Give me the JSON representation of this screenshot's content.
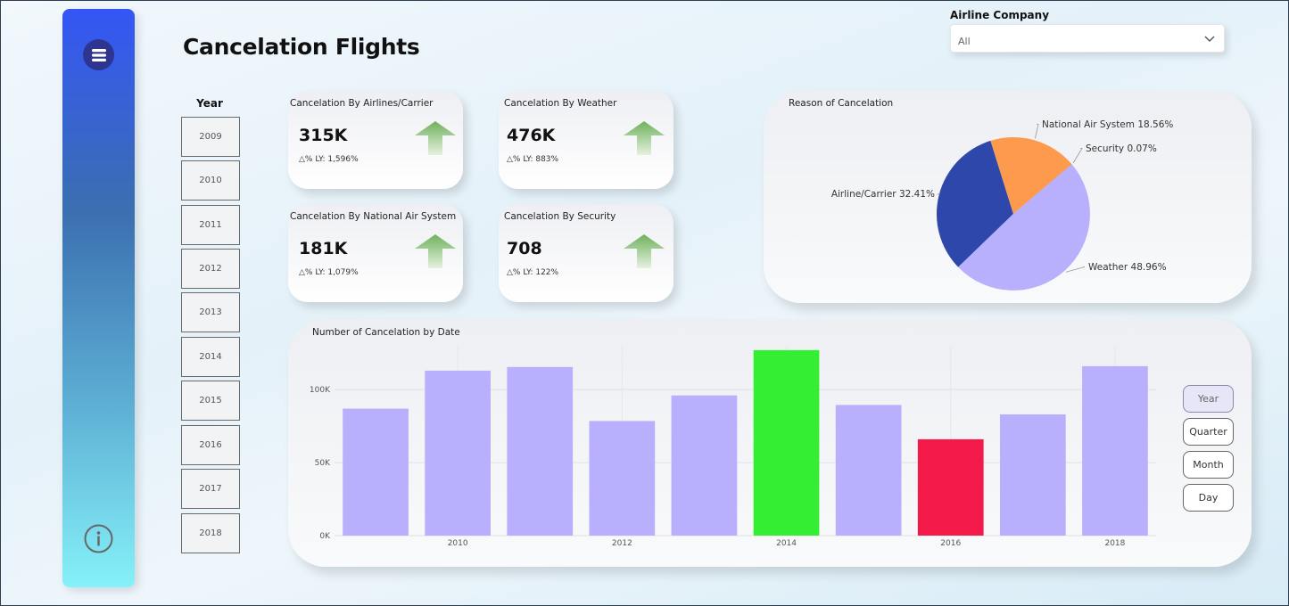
{
  "page": {
    "title": "Cancelation Flights"
  },
  "filter": {
    "label": "Airline Company",
    "value": "All"
  },
  "year_slicer": {
    "label": "Year",
    "years": [
      "2009",
      "2010",
      "2011",
      "2012",
      "2013",
      "2014",
      "2015",
      "2016",
      "2017",
      "2018"
    ]
  },
  "cards": [
    {
      "title": "Cancelation By Airlines/Carrier",
      "value": "315K",
      "ly": "△% LY: 1,596%"
    },
    {
      "title": "Cancelation By Weather",
      "value": "476K",
      "ly": "△% LY: 883%"
    },
    {
      "title": "Cancelation By National Air System",
      "value": "181K",
      "ly": "△% LY: 1,079%"
    },
    {
      "title": "Cancelation By Security",
      "value": "708",
      "ly": "△% LY: 122%"
    }
  ],
  "pie": {
    "title": "Reason of Cancelation"
  },
  "bar": {
    "title": "Number of Cancelation by Date",
    "granularity_buttons": [
      "Year",
      "Quarter",
      "Month",
      "Day"
    ],
    "active_granularity": "Year"
  },
  "colors": {
    "bar_default": "#b8b0fc",
    "bar_max": "#33ee33",
    "bar_min": "#f31a4a",
    "pie_airline": "#2e47ab",
    "pie_nas": "#fe9a4d",
    "pie_security": "#8a8a8a",
    "pie_weather": "#b8b0fc",
    "arrow": "#7cbf6a"
  },
  "chart_data": [
    {
      "type": "pie",
      "title": "Reason of Cancelation",
      "labels": [
        "Airline/Carrier",
        "National Air System",
        "Security",
        "Weather"
      ],
      "values": [
        32.41,
        18.56,
        0.07,
        48.96
      ],
      "value_labels": [
        "32.41%",
        "18.56%",
        "0.07%",
        "48.96%"
      ]
    },
    {
      "type": "bar",
      "title": "Number of Cancelation by Date",
      "x": [
        2009,
        2010,
        2011,
        2012,
        2013,
        2014,
        2015,
        2016,
        2017,
        2018
      ],
      "values": [
        87000,
        113000,
        115500,
        78500,
        96000,
        127000,
        89500,
        66000,
        83000,
        116000
      ],
      "x_tick_labels": [
        "2010",
        "2012",
        "2014",
        "2016",
        "2018"
      ],
      "y_tick_labels": [
        "0K",
        "50K",
        "100K"
      ],
      "ylim": [
        0,
        130000
      ],
      "grid": true
    }
  ]
}
